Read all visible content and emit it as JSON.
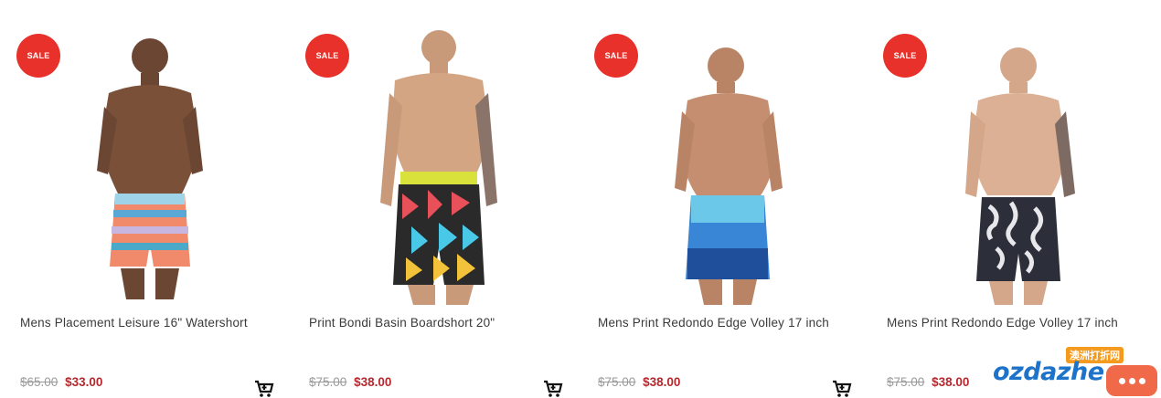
{
  "products": [
    {
      "badge": "SALE",
      "title": "Mens Placement Leisure 16\" Watershort",
      "old_price": "$65.00",
      "new_price": "$33.00",
      "cart_icon": "add-to-cart-icon"
    },
    {
      "badge": "SALE",
      "title": "Print Bondi Basin Boardshort 20\"",
      "old_price": "$75.00",
      "new_price": "$38.00",
      "cart_icon": "add-to-cart-icon"
    },
    {
      "badge": "SALE",
      "title": "Mens Print Redondo Edge Volley 17 inch",
      "old_price": "$75.00",
      "new_price": "$38.00",
      "cart_icon": "add-to-cart-icon"
    },
    {
      "badge": "SALE",
      "title": "Mens Print Redondo Edge Volley 17 inch",
      "old_price": "$75.00",
      "new_price": "$38.00",
      "cart_icon": "add-to-cart-icon"
    }
  ],
  "watermark": {
    "cn_label": "澳洲打折网",
    "brand": "ozdazhe"
  },
  "colors": {
    "sale_badge": "#e8312a",
    "sale_price": "#b5282e",
    "old_price": "#9a9a9a"
  }
}
